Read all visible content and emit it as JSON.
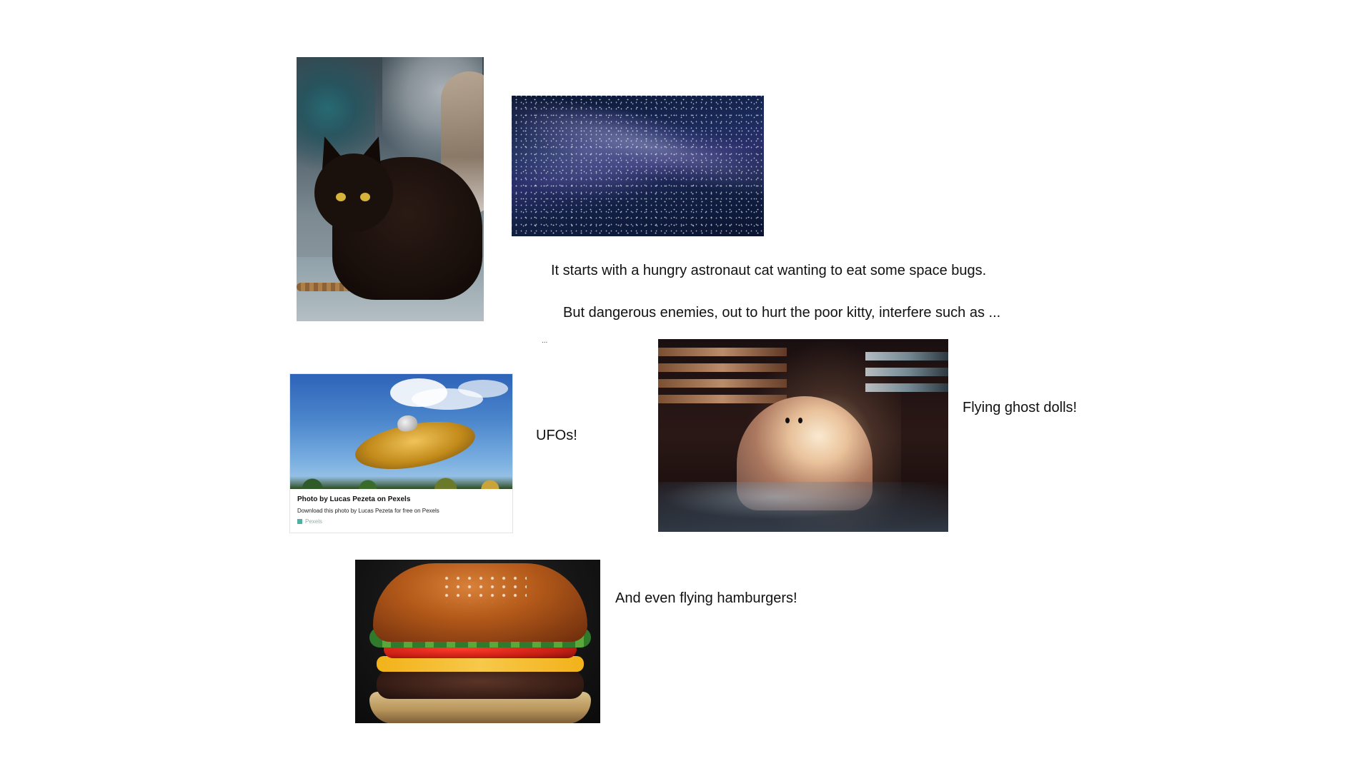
{
  "slide": {
    "captions": {
      "intro": "It starts with a hungry astronaut cat wanting to eat some space bugs.",
      "enemies": "But dangerous enemies, out to hurt the poor kitty, interfere such as ...",
      "dots": "...",
      "ufos": "UFOs!",
      "ghosts": "Flying  ghost dolls!",
      "hamburgers": "And even flying hamburgers!"
    },
    "ufo_card": {
      "title": "Photo by Lucas Pezeta on Pexels",
      "description": "Download this photo by Lucas Pezeta for free on Pexels",
      "source": "Pexels"
    }
  }
}
